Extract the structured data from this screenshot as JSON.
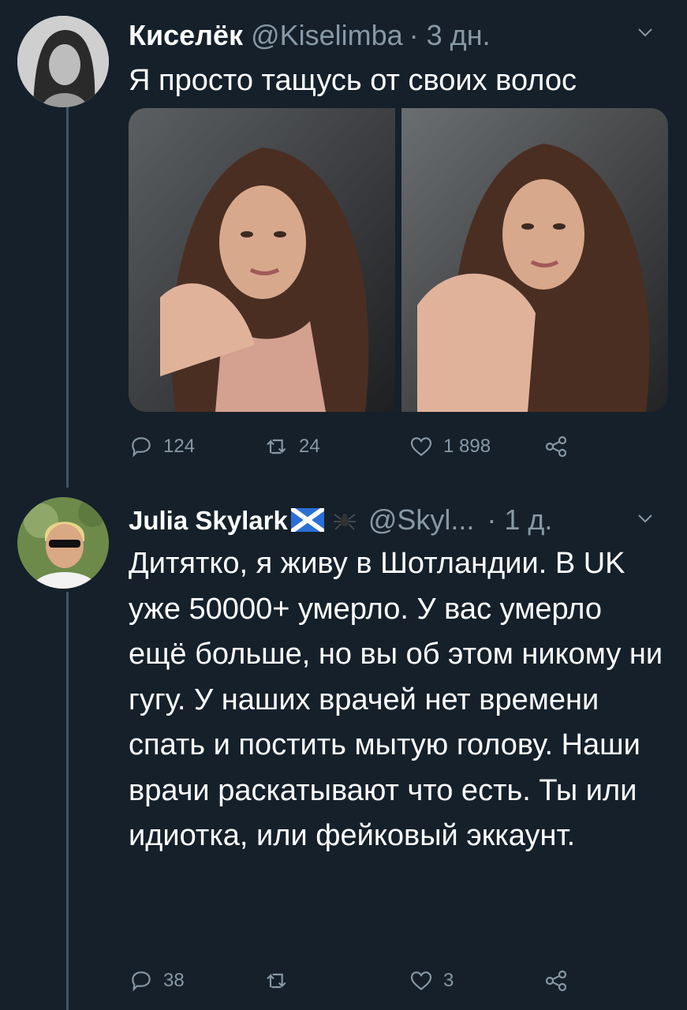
{
  "tweets": [
    {
      "name": "Киселёк",
      "handle": "@Kiselimba",
      "time": "· 3 дн.",
      "text": "Я просто тащусь от своих волос",
      "stats": {
        "replies": "124",
        "retweets": "24",
        "likes": "1 898"
      },
      "icons": [
        "reply-icon",
        "retweet-icon",
        "like-icon",
        "share-icon"
      ]
    },
    {
      "name": "Julia Skylark",
      "name_emoji": "🏴󠁧󠁢󠁳󠁣󠁴󠁿 🕷",
      "handle": "@Skyl...",
      "time": "· 1 д.",
      "text": "Дитятко, я живу в Шотландии. В UK уже 50000+ умерло. У вас умерло ещё больше, но вы об этом никому ни гугу. У наших врачей нет времени спать и постить мытую голову. Наши врачи раскатывают что есть. Ты или идиотка, или фейковый эккаунт.",
      "stats": {
        "replies": "38",
        "retweets": "",
        "likes": "3"
      }
    }
  ],
  "colors": {
    "background": "#15202b",
    "secondary_text": "#8899a6",
    "thread_line": "#3d5466"
  }
}
